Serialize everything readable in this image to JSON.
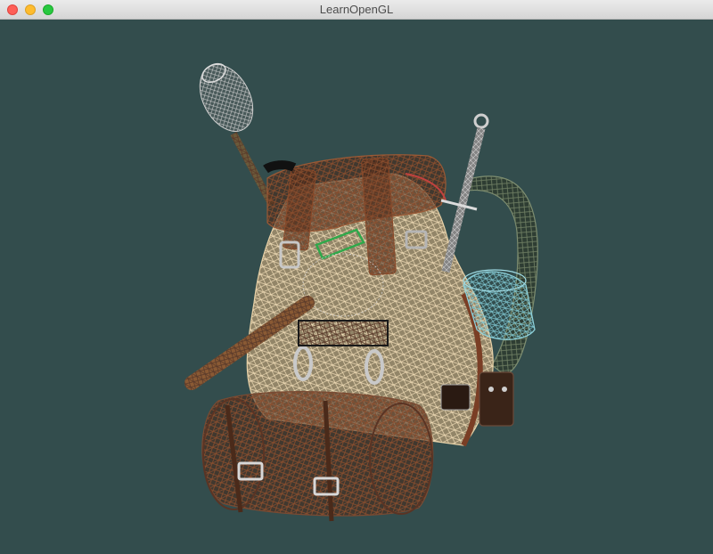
{
  "window": {
    "title": "LearnOpenGL",
    "controls": [
      "close",
      "minimize",
      "zoom"
    ]
  },
  "viewport": {
    "clear_color": "#334d4d",
    "scene": "wireframe-backpack-model",
    "render_mode": "wireframe"
  },
  "colors": {
    "traffic_close": "#fe5f57",
    "traffic_minimize": "#febc2e",
    "traffic_zoom": "#28c840",
    "fabric": "#e2c9a0",
    "leather": "#6b3a22",
    "metal": "#9a9a9a",
    "green_strap": "#2fa84a",
    "teal_cup": "#6fb7c2"
  }
}
